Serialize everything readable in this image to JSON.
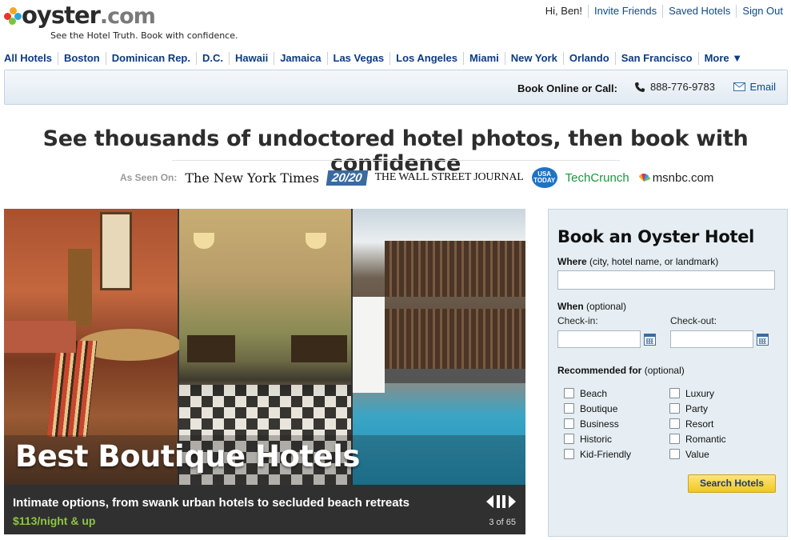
{
  "header": {
    "logo_main": "oyster",
    "logo_suffix": ".com",
    "tagline": "See the Hotel Truth. Book with confidence.",
    "greeting": "Hi, Ben!",
    "links": [
      "Invite Friends",
      "Saved Hotels",
      "Sign Out"
    ]
  },
  "nav": {
    "items": [
      "All Hotels",
      "Boston",
      "Dominican Rep.",
      "D.C.",
      "Hawaii",
      "Jamaica",
      "Las Vegas",
      "Los Angeles",
      "Miami",
      "New York",
      "Orlando",
      "San Francisco",
      "More ▼"
    ]
  },
  "bookbar": {
    "label": "Book Online or Call:",
    "phone": "888-776-9783",
    "email": "Email"
  },
  "headline": "See thousands of undoctored hotel photos, then book with confidence",
  "as_seen_on": {
    "label": "As Seen On:",
    "nyt": "The New York Times",
    "tv": "20/20",
    "wsj": "THE WALL STREET JOURNAL",
    "usa_top": "USA",
    "usa_bottom": "TODAY",
    "techcrunch": "TechCrunch",
    "msnbc": "msnbc.com"
  },
  "hero": {
    "title": "Best Boutique Hotels",
    "description": "Intimate options, from swank urban hotels to secluded beach retreats",
    "price": "$113/night & up",
    "counter": "3 of 65"
  },
  "booking": {
    "title": "Book an Oyster Hotel",
    "where_label": "Where",
    "where_hint": "(city, hotel name, or landmark)",
    "when_label": "When",
    "when_hint": "(optional)",
    "checkin_label": "Check-in:",
    "checkout_label": "Check-out:",
    "recommended_label": "Recommended for",
    "recommended_hint": "(optional)",
    "options_left": [
      "Beach",
      "Boutique",
      "Business",
      "Historic",
      "Kid-Friendly"
    ],
    "options_right": [
      "Luxury",
      "Party",
      "Resort",
      "Romantic",
      "Value"
    ],
    "search_button": "Search Hotels"
  },
  "colors": {
    "link_blue": "#0b3a84",
    "price_green": "#8dc63f",
    "button_yellow": "#f5c623",
    "form_bg": "#e6eef3"
  }
}
